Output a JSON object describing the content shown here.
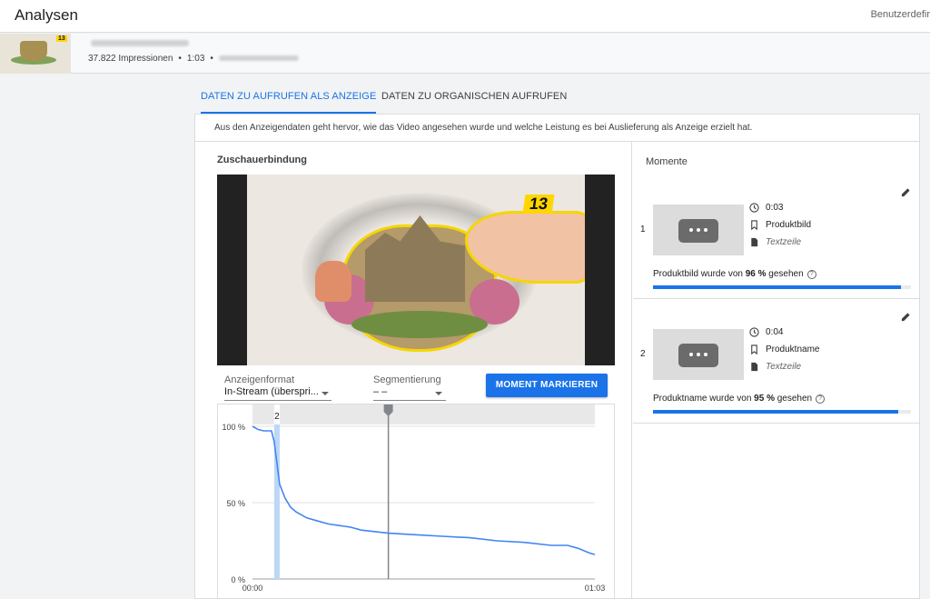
{
  "header": {
    "title": "Analysen",
    "custom_label": "Benutzerdefir"
  },
  "video": {
    "impressions": "37.822 Impressionen",
    "duration": "1:03",
    "separator": "•",
    "thumbnail_badge": "13"
  },
  "tabs": [
    {
      "label": "DATEN ZU AUFRUFEN ALS ANZEIGE",
      "active": true
    },
    {
      "label": "DATEN ZU ORGANISCHEN AUFRUFEN",
      "active": false
    }
  ],
  "description": "Aus den Anzeigendaten geht hervor, wie das Video angesehen wurde und welche Leistung es bei Auslieferung als Anzeige erzielt hat.",
  "retention": {
    "title": "Zuschauerbindung",
    "frame_badge": "13",
    "ad_format": {
      "label": "Anzeigenformat",
      "value": "In-Stream (überspri..."
    },
    "segmentation": {
      "label": "Segmentierung",
      "value": "– –"
    },
    "mark_button": "MOMENT MARKIEREN"
  },
  "chart_data": {
    "type": "line",
    "x_ticks": [
      "00:00",
      "01:03"
    ],
    "y_ticks": [
      "100 %",
      "50 %",
      "0 %"
    ],
    "ylim": [
      0,
      100
    ],
    "xlim": [
      0,
      63
    ],
    "x": [
      0,
      1,
      2,
      3,
      3.5,
      4,
      5,
      6,
      7,
      8,
      10,
      12,
      14,
      16,
      18,
      20,
      25,
      30,
      35,
      40,
      45,
      50,
      55,
      58,
      60,
      62,
      63
    ],
    "values": [
      100,
      98,
      97,
      97,
      97,
      90,
      62,
      53,
      47,
      44,
      40,
      38,
      36,
      35,
      34,
      32,
      30,
      29,
      28,
      27,
      25,
      24,
      22,
      22,
      20,
      17,
      16
    ],
    "markers": [
      {
        "label": "2",
        "x": 4,
        "x_end": 5
      }
    ],
    "playhead_x": 25
  },
  "moments": {
    "title": "Momente",
    "items": [
      {
        "number": "1",
        "time": "0:03",
        "type": "Produktbild",
        "text": "Textzeile",
        "stat_prefix": "Produktbild wurde von ",
        "stat_value": "96 %",
        "stat_suffix": " gesehen",
        "percent": 96
      },
      {
        "number": "2",
        "time": "0:04",
        "type": "Produktname",
        "text": "Textzeile",
        "stat_prefix": "Produktname wurde von ",
        "stat_value": "95 %",
        "stat_suffix": " gesehen",
        "percent": 95
      }
    ]
  },
  "colors": {
    "accent": "#1a73e8",
    "highlight": "#ffd600"
  }
}
